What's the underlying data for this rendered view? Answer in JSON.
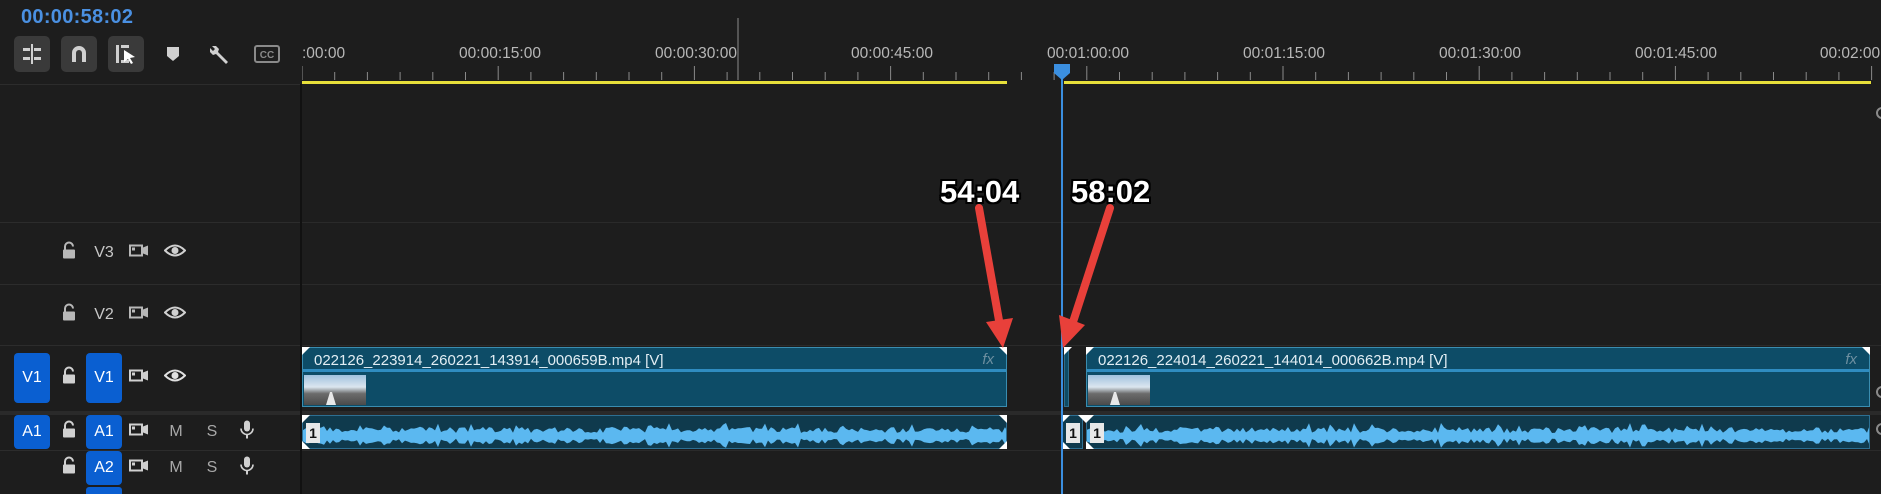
{
  "timecode": "00:00:58:02",
  "toolbar": {
    "tools": [
      "insert-edit-icon",
      "snap-magnet-icon",
      "linked-selection-icon",
      "add-marker-icon",
      "settings-wrench-icon",
      "captions-icon"
    ],
    "captions_label": "CC"
  },
  "ruler": {
    "ticks": [
      ":00:00",
      "00:00:15:00",
      "00:00:30:00",
      "00:00:45:00",
      "00:01:00:00",
      "00:01:15:00",
      "00:01:30:00",
      "00:01:45:00",
      "00:02:00"
    ]
  },
  "tracks": {
    "v3": {
      "label": "V3"
    },
    "v2": {
      "label": "V2"
    },
    "v1": {
      "source": "V1",
      "label": "V1"
    },
    "a1": {
      "source": "A1",
      "label": "A1",
      "mute": "M",
      "solo": "S"
    },
    "a2": {
      "label": "A2",
      "mute": "M",
      "solo": "S"
    }
  },
  "clips": {
    "video_1": {
      "name": "022126_223914_260221_143914_000659B.mp4 [V]",
      "fx": "fx"
    },
    "video_2": {
      "name": "022126_224014_260221_144014_000662B.mp4 [V]",
      "fx": "fx"
    },
    "audio_channel": "1"
  },
  "annotations": {
    "left": "54:04",
    "right": "58:02"
  },
  "colors": {
    "playhead": "#3b8fe0",
    "track_badge": "#0a5fd1",
    "video_clip": "#0d4c67",
    "audio_wave": "#5bb8f0",
    "work_area": "#e7df3a",
    "arrow": "#e8403a"
  }
}
